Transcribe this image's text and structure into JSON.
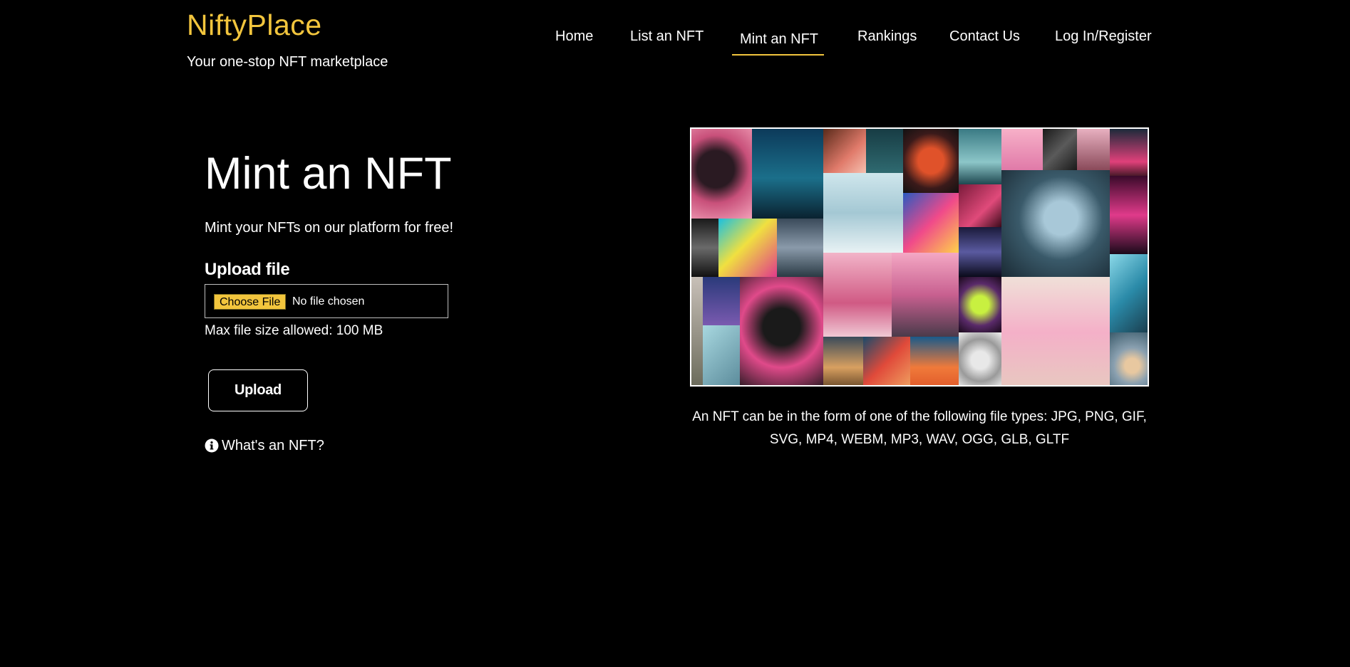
{
  "header": {
    "brand": "NiftyPlace",
    "tagline": "Your one-stop NFT marketplace",
    "nav": [
      {
        "label": "Home"
      },
      {
        "label": "List an NFT"
      },
      {
        "label": "Mint an NFT",
        "active": true
      },
      {
        "label": "Rankings"
      },
      {
        "label": "Contact Us"
      },
      {
        "label": "Log In/Register"
      }
    ]
  },
  "main": {
    "title": "Mint an NFT",
    "subtitle": "Mint your NFTs on our platform for free!",
    "upload_label": "Upload file",
    "file_button_label": "Choose File",
    "file_status": "No file chosen",
    "max_size_text": "Max file size allowed: 100 MB",
    "upload_button_label": "Upload",
    "whats_nft_label": "What's an NFT?"
  },
  "side": {
    "filetypes_text": "An NFT can be in the form of one of the following file types: JPG, PNG, GIF, SVG, MP4, WEBM, MP3, WAV, OGG, GLB, GLTF"
  },
  "colors": {
    "accent": "#f2c53d",
    "background": "#000000",
    "text": "#ffffff"
  },
  "icons": {
    "info": "info-circle-icon"
  }
}
